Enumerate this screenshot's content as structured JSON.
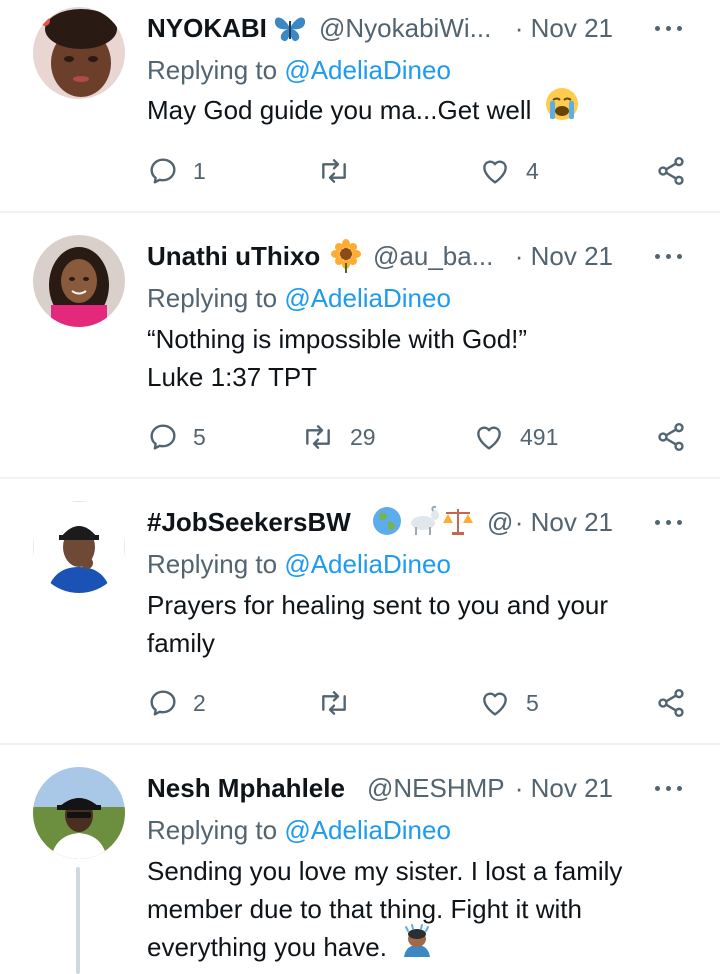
{
  "reply_prefix": "Replying to",
  "tweets": [
    {
      "name": "NYOKABI",
      "handle": "@NyokabiWi...",
      "date": "· Nov 21",
      "replying_to": "@AdeliaDineo",
      "text_lines": [
        "May God guide you ma...Get well"
      ],
      "name_emoji": "butterfly",
      "text_emoji": "loudly-crying-face",
      "replies": "1",
      "retweets": "",
      "likes": "4"
    },
    {
      "name": "Unathi uThixo",
      "handle": "@au_ba...",
      "date": "· Nov 21",
      "replying_to": "@AdeliaDineo",
      "text_lines": [
        "“Nothing is impossible with God!”",
        "Luke 1:37 TPT"
      ],
      "name_emoji": "sunflower",
      "replies": "5",
      "retweets": "29",
      "likes": "491"
    },
    {
      "name": "#JobSeekersBW",
      "handle": "@",
      "date": "· Nov 21",
      "replying_to": "@AdeliaDineo",
      "text_lines": [
        "Prayers for healing sent to you and your",
        "family"
      ],
      "name_emoji": "globe, goat, balance-scale",
      "replies": "2",
      "retweets": "",
      "likes": "5"
    },
    {
      "name": "Nesh Mphahlele",
      "handle": "@NESHMP",
      "date": "· Nov 21",
      "replying_to": "@AdeliaDineo",
      "text_lines": [
        "Sending you love my sister. I lost a family",
        "member due to that thing. Fight it with",
        "everything you have."
      ],
      "text_emoji": "person-bowing"
    }
  ],
  "colors": {
    "text": "#0f1419",
    "secondary": "#536471",
    "link": "#1d9bf0",
    "divider": "#eff3f4"
  }
}
